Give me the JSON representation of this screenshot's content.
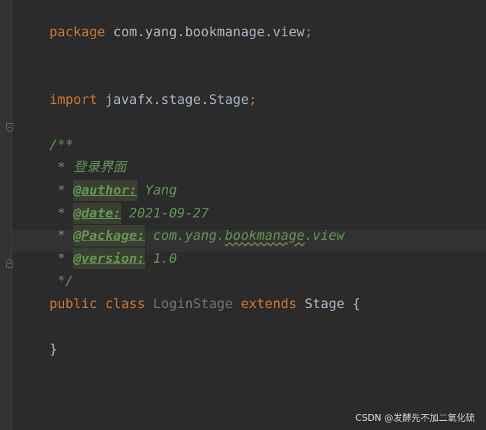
{
  "editor": {
    "lines": {
      "package_kw": "package",
      "package_name": "com.yang.bookmanage.view",
      "package_semi": ";",
      "import_kw": "import",
      "import_name": "javafx.stage.Stage",
      "import_semi": ";",
      "doc_open": "/**",
      "doc_star": " * ",
      "doc_title": "登录界面",
      "author_tag": "@author:",
      "author_value": " Yang",
      "date_tag": "@date:",
      "date_value": " 2021-09-27",
      "package_tag": "@Package:",
      "package_value_pre": " com.yang.",
      "package_value_squiggle": "bookmanage",
      "package_value_post": ".view",
      "version_tag": "@version:",
      "version_value": " 1.0",
      "doc_close": " */",
      "public_kw": "public",
      "class_kw": "class",
      "class_name": "LoginStage",
      "extends_kw": "extends",
      "super_name": "Stage",
      "open_brace": "{",
      "close_brace": "}"
    }
  },
  "watermark": "CSDN @发酵先不加二氧化硫",
  "colors": {
    "background": "#2b2b2b",
    "keyword": "#cc7832",
    "doc_comment": "#629755",
    "text": "#a9b7c6",
    "unused_class": "#72737a"
  }
}
